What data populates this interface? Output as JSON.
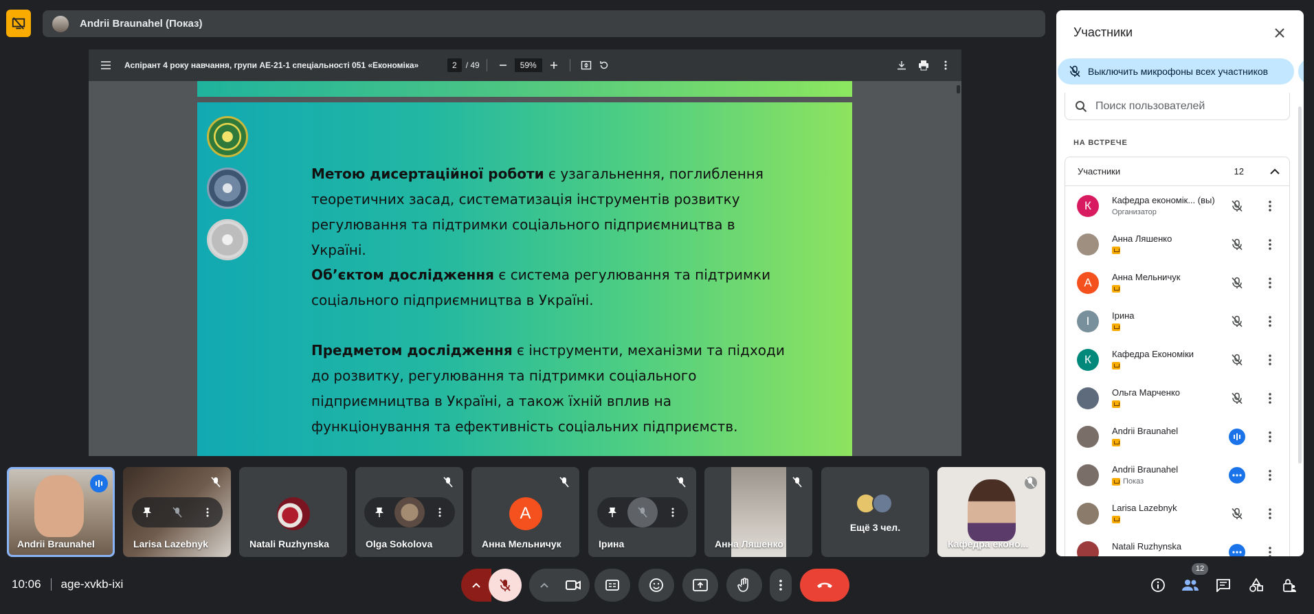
{
  "header": {
    "presenter_name": "Andrii Braunahel (Показ)"
  },
  "pdf": {
    "title": "Аспірант 4 року навчання, групи АЕ-21-1 спеціальності 051 «Економіка»",
    "page_current": "2",
    "page_total": "/ 49",
    "zoom": "59%",
    "slide": {
      "p1_bold": "Метою дисертаційної роботи",
      "p1_rest": " є узагальнення, поглиблення теоретичних засад, систематизація інструментів розвитку регулювання та підтримки соціального підприємництва в Україні.",
      "p2_bold": "Об’єктом дослідження",
      "p2_rest": " є система регулювання та підтримки соціального підприємництва в Україні.",
      "p3_bold": "Предметом дослідження",
      "p3_rest": " є інструменти, механізми та підходи до розвитку, регулювання та підтримки соціального підприємництва в Україні, а також їхній вплив на функціонування та ефективність соціальних підприємств."
    }
  },
  "tiles": [
    {
      "name": "Andrii Braunahel"
    },
    {
      "name": "Larisa Lazebnyk"
    },
    {
      "name": "Natali Ruzhynska"
    },
    {
      "name": "Olga Sokolova"
    },
    {
      "name": "Анна Мельничук",
      "initial": "А"
    },
    {
      "name": "Ірина"
    },
    {
      "name": "Анна Ляшенко"
    },
    {
      "name": "Ещё 3 чел."
    },
    {
      "name": "Кафедра еконо..."
    }
  ],
  "bottom": {
    "time": "10:06",
    "meeting_code": "age-xvkb-ixi",
    "participants_badge": "12"
  },
  "panel": {
    "title": "Участники",
    "mute_all": "Выключить микрофоны всех участников",
    "search_placeholder": "Поиск пользователей",
    "section": "НА ВСТРЕЧЕ",
    "group_label": "Участники",
    "group_count": "12",
    "participants": [
      {
        "name": "Кафедра економік...  (вы)",
        "sub": "Организатор",
        "initial": "К",
        "color": "#d81b60",
        "presenting": false,
        "status": "muted"
      },
      {
        "name": "Анна Ляшенко",
        "sub": "",
        "initial": "",
        "color": "#9e8f80",
        "presenting": true,
        "status": "muted"
      },
      {
        "name": "Анна Мельничук",
        "sub": "",
        "initial": "А",
        "color": "#f4511e",
        "presenting": true,
        "status": "muted"
      },
      {
        "name": "Ірина",
        "sub": "",
        "initial": "І",
        "color": "#78909c",
        "presenting": true,
        "status": "muted"
      },
      {
        "name": "Кафедра Економіки",
        "sub": "",
        "initial": "К",
        "color": "#00897b",
        "presenting": true,
        "status": "muted"
      },
      {
        "name": "Ольга Марченко",
        "sub": "",
        "initial": "",
        "color": "#5d6b7d",
        "presenting": true,
        "status": "muted"
      },
      {
        "name": "Andrii Braunahel",
        "sub": "",
        "initial": "",
        "color": "#7a6f68",
        "presenting": true,
        "status": "speaking"
      },
      {
        "name": "Andrii Braunahel",
        "sub": "Показ",
        "initial": "",
        "color": "#7a6f68",
        "presenting": true,
        "status": "more"
      },
      {
        "name": "Larisa Lazebnyk",
        "sub": "",
        "initial": "",
        "color": "#8b7b6b",
        "presenting": true,
        "status": "muted"
      },
      {
        "name": "Natali Ruzhynska",
        "sub": "",
        "initial": "",
        "color": "#9c3b3b",
        "presenting": false,
        "status": "more"
      }
    ]
  }
}
